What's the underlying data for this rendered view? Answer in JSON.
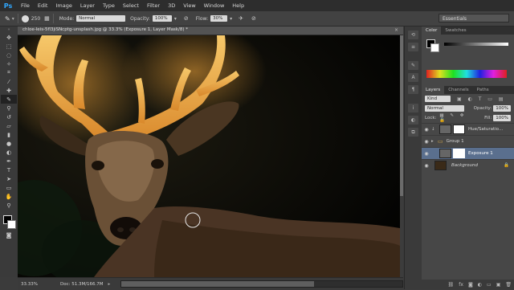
{
  "app": {
    "logo": "Ps"
  },
  "menu": [
    "File",
    "Edit",
    "Image",
    "Layer",
    "Type",
    "Select",
    "Filter",
    "3D",
    "View",
    "Window",
    "Help"
  ],
  "options": {
    "brush_size": "250",
    "mode_label": "Mode:",
    "mode_value": "Normal",
    "opacity_label": "Opacity:",
    "opacity_value": "100%",
    "flow_label": "Flow:",
    "flow_value": "30%"
  },
  "workspace": "Essentials",
  "document": {
    "tab_label": "chloe-leis-5fl3jiSNcptg-unsplash.jpg @ 33.3% (Exposure 1, Layer Mask/8) *"
  },
  "status": {
    "zoom": "33.33%",
    "doc_size": "Doc: 51.3M/166.7M"
  },
  "color_panel": {
    "tabs": [
      "Color",
      "Swatches"
    ]
  },
  "layers_panel": {
    "tabs": [
      "Layers",
      "Channels",
      "Paths"
    ],
    "kind": "Kind",
    "blend_mode": "Normal",
    "opacity_label": "Opacity:",
    "opacity_value": "100%",
    "lock_label": "Lock:",
    "fill_label": "Fill:",
    "fill_value": "100%",
    "layers": [
      {
        "name": "Hue/Saturatio...",
        "selected": false
      },
      {
        "name": "Group 1",
        "selected": false
      },
      {
        "name": "Exposure 1",
        "selected": true
      },
      {
        "name": "Background",
        "selected": false
      }
    ]
  },
  "colors": {
    "accent": "#31a8ff",
    "selection": "#5a6f8e"
  },
  "icons": {
    "toolbox": [
      "move-icon",
      "marquee-icon",
      "lasso-icon",
      "quick-select-icon",
      "crop-icon",
      "eyedropper-icon",
      "healing-icon",
      "brush-icon",
      "clone-stamp-icon",
      "history-brush-icon",
      "eraser-icon",
      "gradient-icon",
      "blur-icon",
      "dodge-icon",
      "pen-icon",
      "type-icon",
      "path-select-icon",
      "shape-icon",
      "hand-icon",
      "zoom-icon"
    ]
  }
}
